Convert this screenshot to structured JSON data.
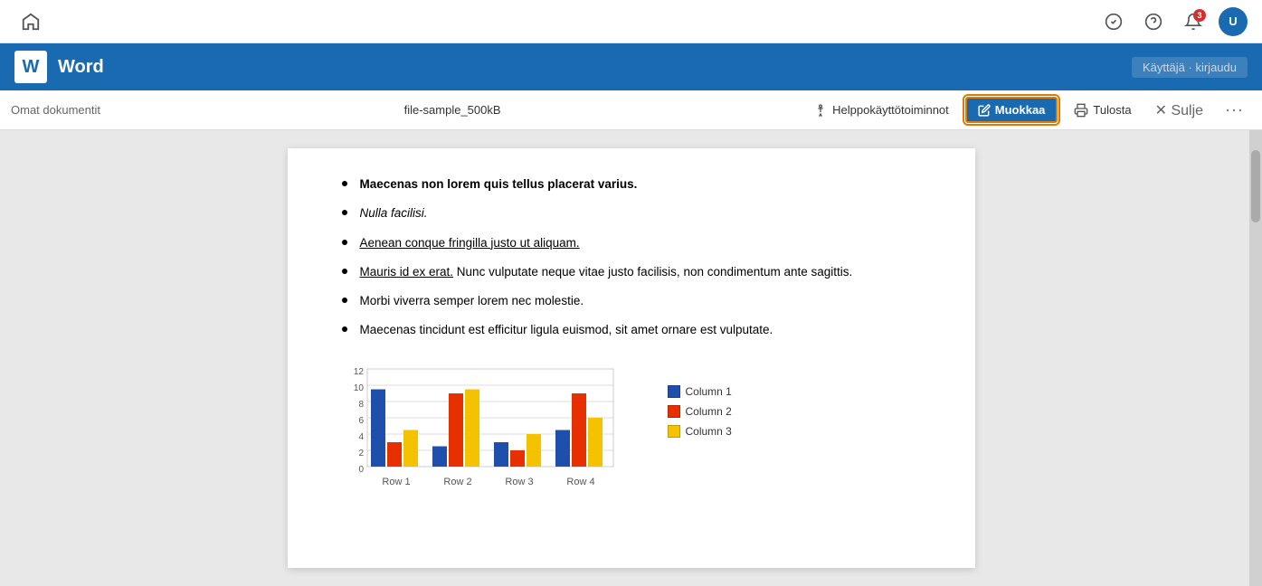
{
  "systemBar": {
    "homeIcon": "⌂",
    "icons": {
      "checkIcon": "✓",
      "helpIcon": "?",
      "bellIcon": "🔔",
      "notifCount": "3",
      "avatarLabel": "U"
    }
  },
  "wordHeader": {
    "logoText": "W",
    "title": "Word",
    "userText": "Käyttäjä · kirjaudu"
  },
  "docToolbar": {
    "myDocsLabel": "Omat dokumentit",
    "filename": "file-sample_500kB",
    "helpLabel": "Helppokäyttötoiminnot",
    "editLabel": "Muokkaa",
    "printLabel": "Tulosta",
    "closeLabel": "Sulje",
    "moreLabel": "···",
    "pencilIcon": "✏"
  },
  "document": {
    "bullets": [
      {
        "id": 1,
        "text": "Maecenas non lorem quis tellus placerat varius.",
        "bold": true,
        "italic": false,
        "underline": false
      },
      {
        "id": 2,
        "text": "Nulla facilisi.",
        "bold": false,
        "italic": true,
        "underline": false
      },
      {
        "id": 3,
        "text": "Aenean conque fringilla justo ut aliquam.",
        "bold": false,
        "italic": false,
        "underline": true
      },
      {
        "id": 4,
        "textParts": [
          {
            "text": "Mauris id ex erat. ",
            "bold": false,
            "italic": false,
            "underline": true
          },
          {
            "text": "Nunc vulputate neque vitae justo facilisis, non condimentum ante sagittis.",
            "bold": false,
            "italic": false,
            "underline": false
          }
        ],
        "multipart": true
      },
      {
        "id": 5,
        "text": "Morbi viverra semper lorem nec molestie.",
        "bold": false,
        "italic": false,
        "underline": false
      },
      {
        "id": 6,
        "text": "Maecenas tincidunt est efficitur ligula euismod, sit amet ornare est vulputate.",
        "bold": false,
        "italic": false,
        "underline": false
      }
    ],
    "chart": {
      "title": "",
      "xLabels": [
        "Row 1",
        "Row 2",
        "Row 3",
        "Row 4"
      ],
      "yMax": 12,
      "yTicks": [
        0,
        2,
        4,
        6,
        8,
        10,
        12
      ],
      "series": [
        {
          "name": "Column 1",
          "color": "#1e4faa",
          "values": [
            9.5,
            2.5,
            3,
            4.5
          ]
        },
        {
          "name": "Column 2",
          "color": "#e63000",
          "values": [
            3,
            9,
            2,
            9
          ]
        },
        {
          "name": "Column 3",
          "color": "#f5c200",
          "values": [
            4.5,
            9.5,
            4,
            6
          ]
        }
      ],
      "legend": [
        {
          "label": "Column 1",
          "color": "#1e4faa"
        },
        {
          "label": "Column 2",
          "color": "#e63000"
        },
        {
          "label": "Column 3",
          "color": "#f5c200"
        }
      ]
    }
  }
}
